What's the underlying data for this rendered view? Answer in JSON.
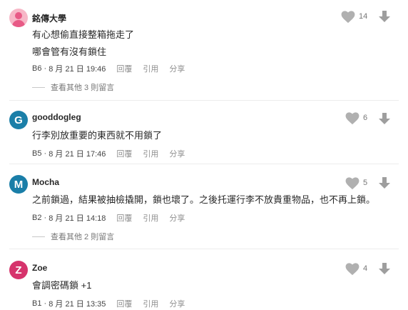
{
  "ui": {
    "like_color": "#b0b0b0"
  },
  "comments": [
    {
      "author": "銘傳大學",
      "avatar_letter": "",
      "avatar_color": "#f7b7c7",
      "lines": [
        "有心想偷直接整箱拖走了",
        "哪會管有沒有鎖住"
      ],
      "floor": "B6",
      "datetime": "8 月 21 日 19:46",
      "reply_label": "回覆",
      "quote_label": "引用",
      "share_label": "分享",
      "likes": "14",
      "more_replies": "查看其他 3 則留言"
    },
    {
      "author": "gooddogleg",
      "avatar_letter": "G",
      "avatar_color": "#1b7fa8",
      "lines": [
        "行李別放重要的東西就不用鎖了"
      ],
      "floor": "B5",
      "datetime": "8 月 21 日 17:46",
      "reply_label": "回覆",
      "quote_label": "引用",
      "share_label": "分享",
      "likes": "6",
      "more_replies": ""
    },
    {
      "author": "Mocha",
      "avatar_letter": "M",
      "avatar_color": "#1a7ea8",
      "lines": [
        "之前鎖過，結果被抽檢撬開，鎖也壞了。之後托運行李不放貴重物品，也不再上鎖。"
      ],
      "floor": "B2",
      "datetime": "8 月 21 日 14:18",
      "reply_label": "回覆",
      "quote_label": "引用",
      "share_label": "分享",
      "likes": "5",
      "more_replies": "查看其他 2 則留言"
    },
    {
      "author": "Zoe",
      "avatar_letter": "Z",
      "avatar_color": "#d6336c",
      "lines": [
        "會調密碼鎖 +1"
      ],
      "floor": "B1",
      "datetime": "8 月 21 日 13:35",
      "reply_label": "回覆",
      "quote_label": "引用",
      "share_label": "分享",
      "likes": "4",
      "more_replies": ""
    }
  ]
}
